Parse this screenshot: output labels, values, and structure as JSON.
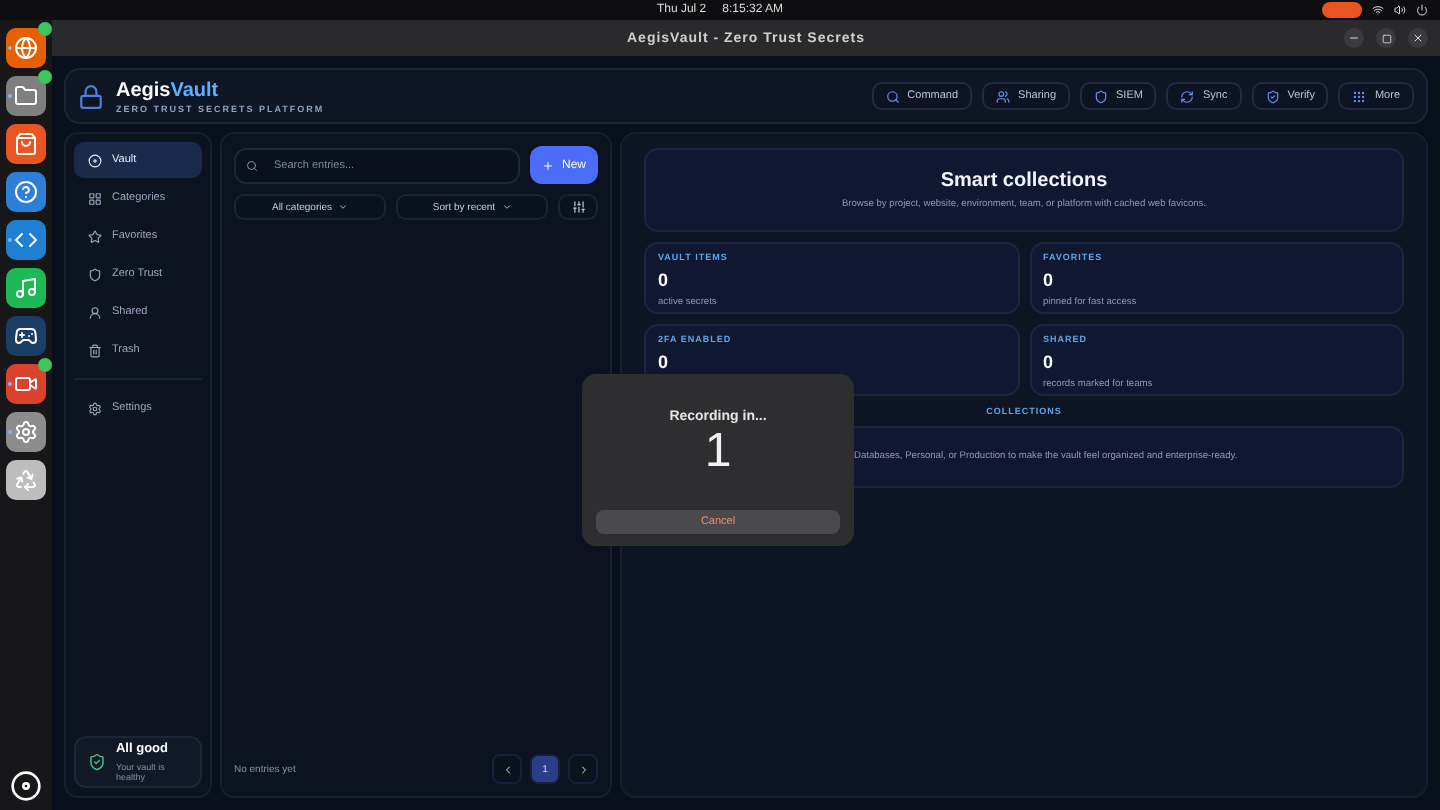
{
  "top_bar": {
    "date": "Thu Jul 2",
    "time": "8:15:32 AM"
  },
  "dock": {
    "apps": [
      {
        "kind": "browser",
        "badge": true,
        "running": true
      },
      {
        "kind": "files",
        "badge": true,
        "running": true
      },
      {
        "kind": "store",
        "badge": false,
        "running": false
      },
      {
        "kind": "help",
        "badge": false,
        "running": false
      },
      {
        "kind": "code",
        "badge": false,
        "running": true
      },
      {
        "kind": "music",
        "badge": false,
        "running": false
      },
      {
        "kind": "game",
        "badge": false,
        "running": false
      },
      {
        "kind": "recorder",
        "badge": true,
        "running": true
      },
      {
        "kind": "settings",
        "badge": false,
        "running": true
      },
      {
        "kind": "trash",
        "badge": false,
        "running": false
      }
    ]
  },
  "window": {
    "title": "AegisVault - Zero Trust Secrets"
  },
  "header": {
    "brand_first": "Aegis",
    "brand_second": "Vault",
    "subtitle": "ZERO TRUST SECRETS PLATFORM",
    "actions": [
      {
        "kind": "command",
        "label": "Command"
      },
      {
        "kind": "sharing",
        "label": "Sharing"
      },
      {
        "kind": "siem",
        "label": "SIEM"
      },
      {
        "kind": "sync",
        "label": "Sync"
      },
      {
        "kind": "verify",
        "label": "Verify"
      },
      {
        "kind": "more",
        "label": "More"
      }
    ]
  },
  "sidebar": {
    "items": [
      {
        "kind": "vault",
        "label": "Vault",
        "selected": true
      },
      {
        "kind": "categories",
        "label": "Categories",
        "selected": false
      },
      {
        "kind": "favorites",
        "label": "Favorites",
        "selected": false
      },
      {
        "kind": "zero_trust",
        "label": "Zero Trust",
        "selected": false
      },
      {
        "kind": "shared",
        "label": "Shared",
        "selected": false
      },
      {
        "kind": "trash",
        "label": "Trash",
        "selected": false
      }
    ],
    "settings": {
      "label": "Settings",
      "selected": false
    },
    "status": {
      "title": "All good",
      "text": "Your vault is healthy"
    }
  },
  "list": {
    "search": {
      "placeholder": "Search entries..."
    },
    "new_button": "New",
    "filters": [
      "All categories",
      "Sort by recent"
    ],
    "empty": "No entries yet",
    "pages": [
      {
        "label": "1",
        "selected": true
      }
    ]
  },
  "smart": {
    "title": "Smart collections",
    "subtitle": "Browse by project, website, environment, team, or platform with cached web favicons.",
    "stats": [
      {
        "label": "VAULT ITEMS",
        "value": "0",
        "note": "active secrets"
      },
      {
        "label": "FAVORITES",
        "value": "0",
        "note": "pinned for fast access"
      },
      {
        "label": "2FA ENABLED",
        "value": "0"
      },
      {
        "label": "SHARED",
        "value": "0",
        "note": "records marked for teams"
      }
    ],
    "collections_label": "COLLECTIONS",
    "collections_text": "Databases, Personal, or Production to make the vault feel organized and enterprise-ready."
  },
  "dialog": {
    "title": "Recording in...",
    "count": "1",
    "cancel": "Cancel"
  }
}
